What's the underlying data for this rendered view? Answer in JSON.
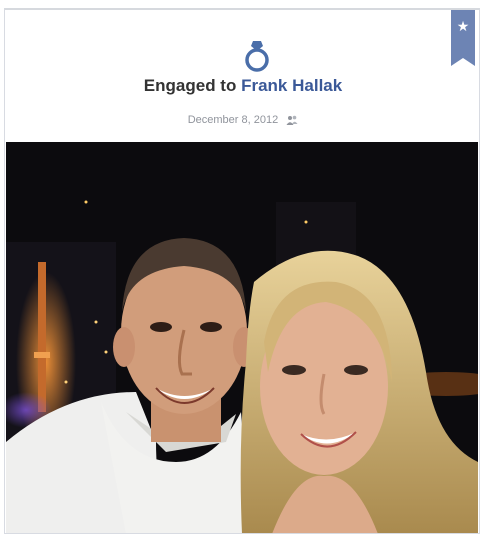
{
  "event": {
    "prefix": "Engaged to",
    "partner_name": "Frank Hallak",
    "date": "December 8, 2012"
  },
  "icons": {
    "badge": "star-icon",
    "event": "ring-icon",
    "privacy": "friends-icon"
  },
  "colors": {
    "link": "#3b5998",
    "ribbon": "#6d84b4",
    "ring": "#4a6ea9",
    "muted": "#90949c"
  }
}
